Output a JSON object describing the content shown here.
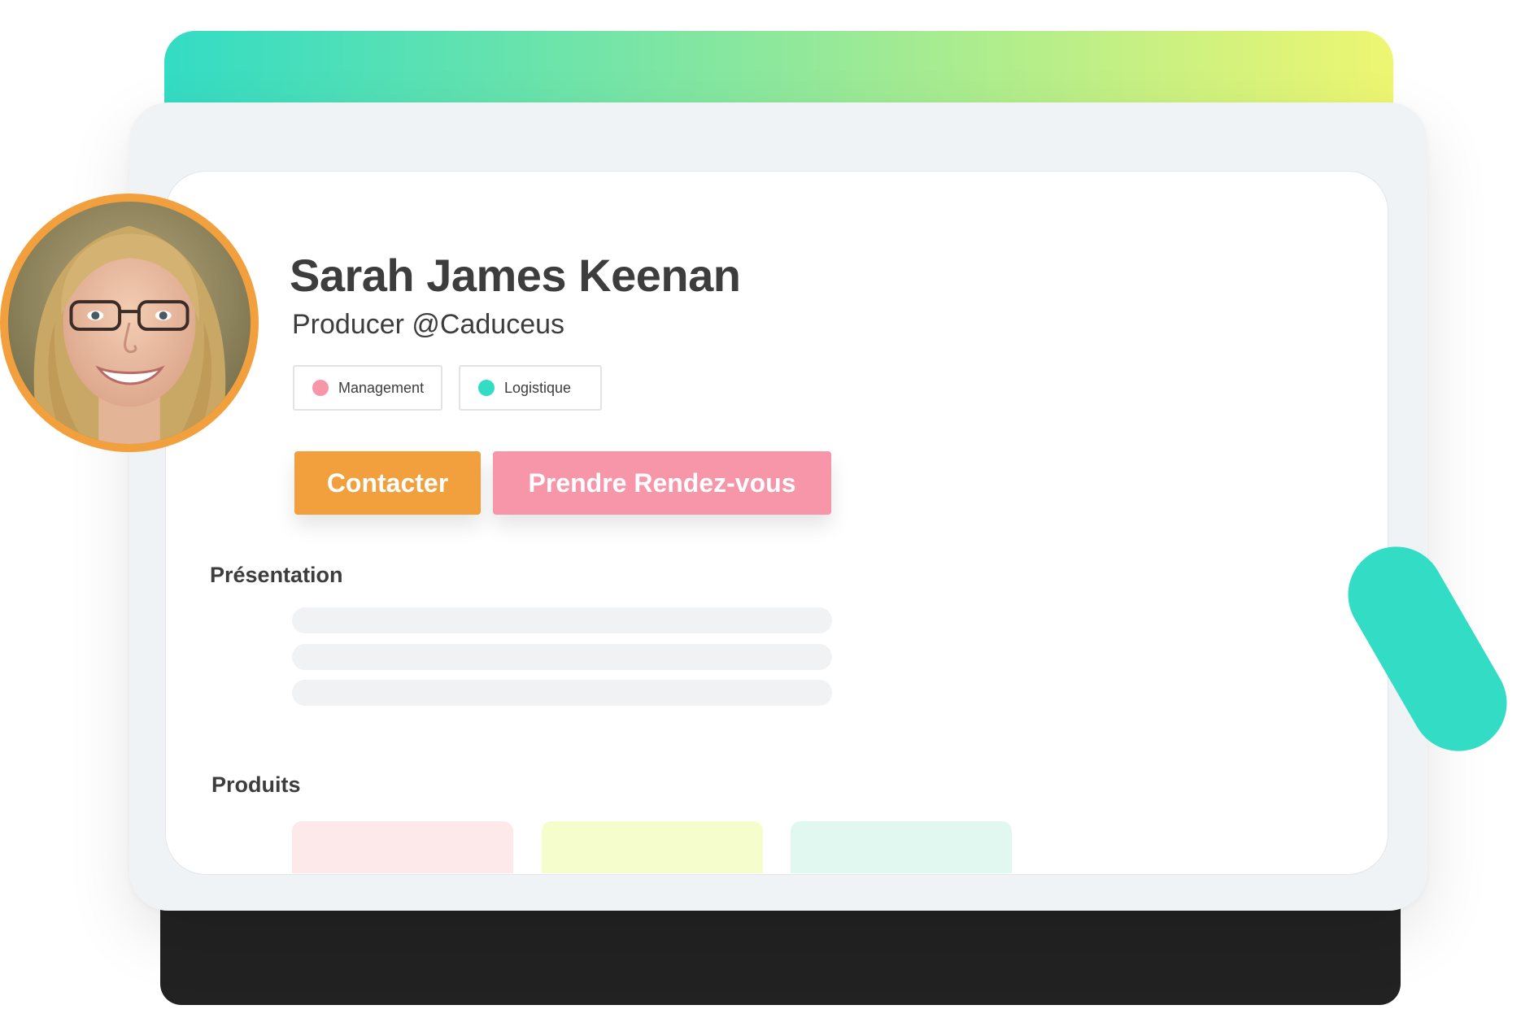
{
  "profile": {
    "name": "Sarah James Keenan",
    "role": "Producer @Caduceus",
    "avatar_alt": "Sarah James Keenan"
  },
  "tags": [
    {
      "label": "Management",
      "color": "#f795a9"
    },
    {
      "label": "Logistique",
      "color": "#33dcc4"
    }
  ],
  "actions": {
    "contact_label": "Contacter",
    "appointment_label": "Prendre Rendez-vous"
  },
  "sections": {
    "presentation_title": "Présentation",
    "products_title": "Produits"
  },
  "colors": {
    "accent_orange": "#f2a03d",
    "accent_pink": "#f795a9",
    "accent_teal": "#33dcc4",
    "product_pink": "#fde9ea",
    "product_yellow": "#f6fdcc",
    "product_mint": "#e1f8f1"
  }
}
